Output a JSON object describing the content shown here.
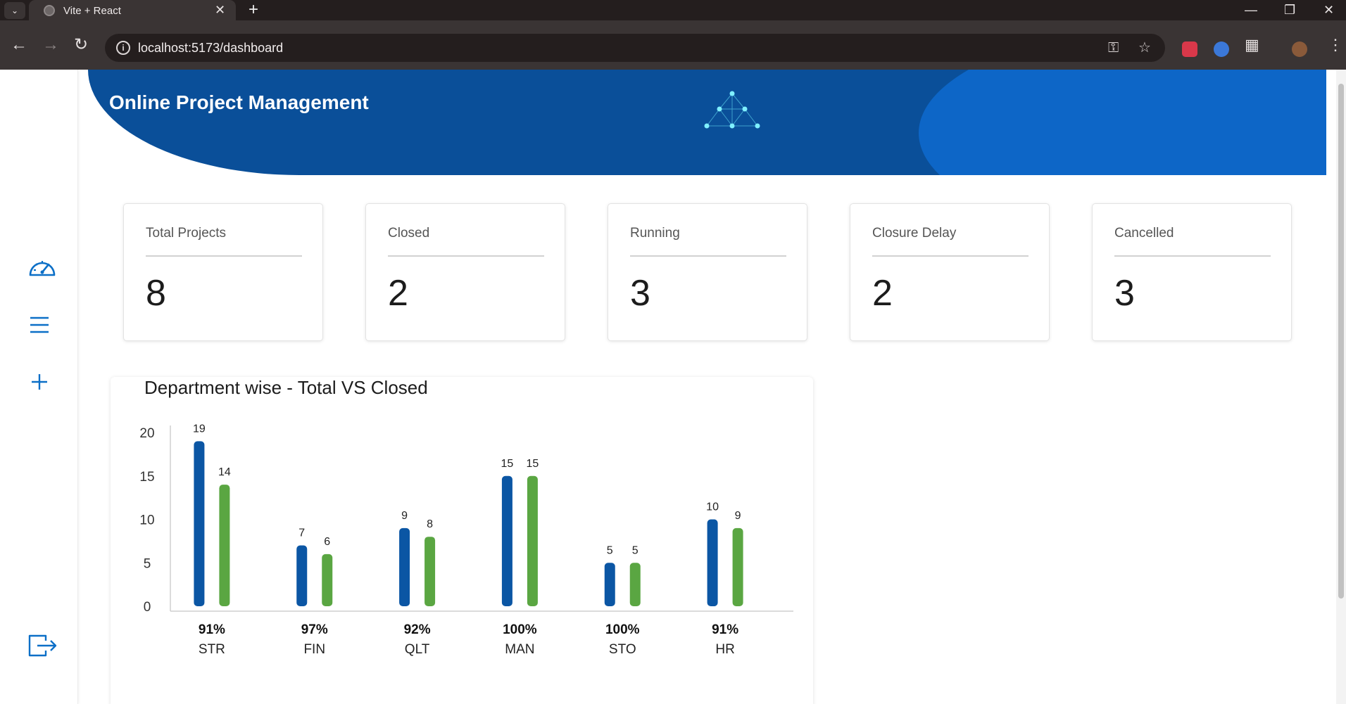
{
  "browser": {
    "tab_title": "Vite + React",
    "url": "localhost:5173/dashboard",
    "icons": {
      "tab_menu": "chevron-down-icon",
      "close": "close-icon",
      "new_tab": "plus-icon",
      "back": "arrow-left-icon",
      "forward": "arrow-right-icon",
      "reload": "reload-icon",
      "site_info": "info-icon",
      "password": "key-icon",
      "bookmark": "star-icon",
      "extensions": "puzzle-icon",
      "menu": "kebab-menu-icon"
    }
  },
  "sidebar": {
    "items": [
      {
        "icon": "dashboard-gauge-icon"
      },
      {
        "icon": "hamburger-list-icon"
      },
      {
        "icon": "plus-icon"
      },
      {
        "icon": "logout-icon"
      }
    ],
    "accent": "#0b6fc7"
  },
  "banner": {
    "title": "Online Project Management",
    "colors": {
      "base": "#0a4f99",
      "accent": "#0d66c7",
      "logo": "#7ff0ff"
    }
  },
  "stats": [
    {
      "label": "Total Projects",
      "value": "8"
    },
    {
      "label": "Closed",
      "value": "2"
    },
    {
      "label": "Running",
      "value": "3"
    },
    {
      "label": "Closure Delay",
      "value": "2"
    },
    {
      "label": "Cancelled",
      "value": "3"
    }
  ],
  "chart_card": {
    "title": "Department wise - Total VS Closed"
  },
  "chart_data": {
    "type": "bar",
    "categories": [
      "STR",
      "FIN",
      "QLT",
      "MAN",
      "STO",
      "HR"
    ],
    "series": [
      {
        "values": [
          19,
          7,
          9,
          15,
          5,
          10
        ],
        "color": "#0b56a4"
      },
      {
        "values": [
          14,
          6,
          8,
          15,
          5,
          9
        ],
        "color": "#5aa642"
      }
    ],
    "percentages": [
      "91%",
      "97%",
      "92%",
      "100%",
      "100%",
      "91%"
    ],
    "y_ticks": [
      0,
      5,
      10,
      15,
      20
    ],
    "ylim": [
      0,
      20
    ],
    "grid": false,
    "legend": "none"
  }
}
